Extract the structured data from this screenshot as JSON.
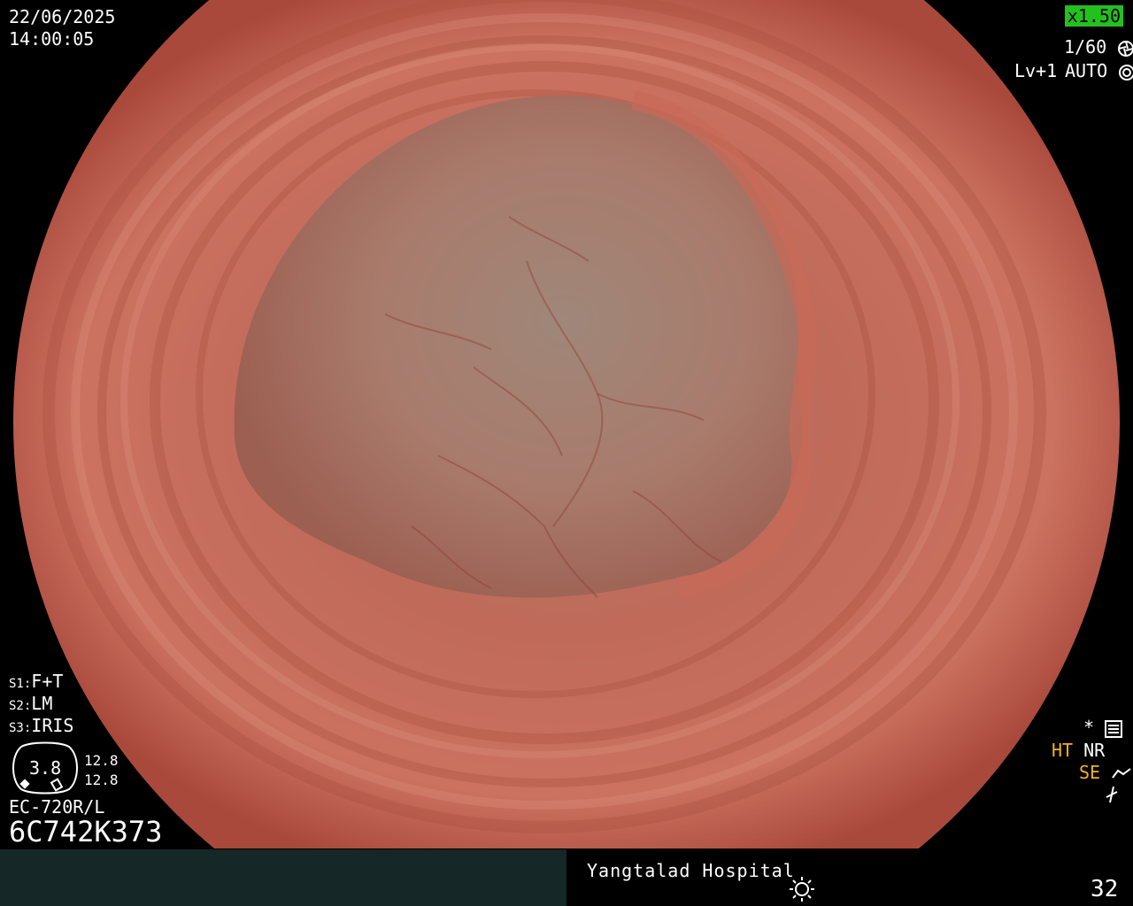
{
  "header": {
    "date": "22/06/2025",
    "time": "14:00:05",
    "zoom": "x1.50",
    "shutter": "1/60",
    "level": "Lv+1",
    "iris_mode": "AUTO"
  },
  "switches": {
    "s1_key": "S1:",
    "s1_val": "F+T",
    "s2_key": "S2:",
    "s2_val": "LM",
    "s3_key": "S3:",
    "s3_val": "IRIS"
  },
  "scope_gauge": {
    "center": "3.8",
    "upper": "12.8",
    "lower": "12.8"
  },
  "scope_model": "EC-720R/L",
  "scope_serial": "6C742K373",
  "right_panel": {
    "star": "*",
    "ht": "HT",
    "nr": "NR",
    "se": "SE"
  },
  "footer": {
    "hospital": "Yangtalad Hospital",
    "counter": "32"
  },
  "colors": {
    "zoom_bg": "#23c11e",
    "accent_orange": "#f2b21a",
    "tissue": "#c0685a",
    "footer_bar": "#152726"
  },
  "icons": [
    "aperture-icon",
    "iris-icon",
    "settings-icon",
    "enhance-icon",
    "flash-icon",
    "sun-icon"
  ]
}
